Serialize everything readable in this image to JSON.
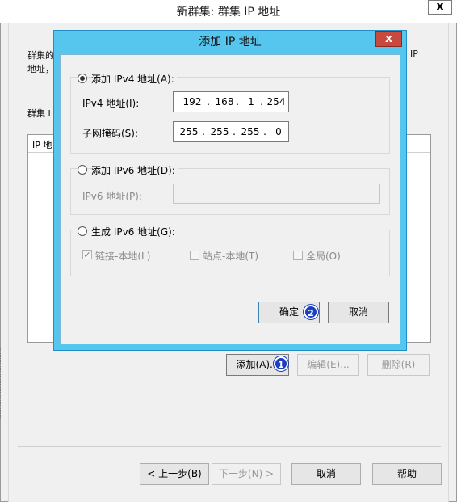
{
  "outer": {
    "title": "新群集: 群集 IP 地址",
    "close_label": "x",
    "desc_line1_left": "群集的",
    "desc_line1_right": "IP",
    "desc_line2": "地址，",
    "section_label": "群集 I",
    "list_header": "IP 地",
    "buttons": {
      "add": "添加(A)...",
      "edit": "编辑(E)...",
      "delete": "删除(R)"
    },
    "nav": {
      "back": "< 上一步(B)",
      "next": "下一步(N) >",
      "cancel": "取消",
      "help": "帮助"
    }
  },
  "dialog": {
    "title": "添加 IP 地址",
    "close_label": "x",
    "ipv4_option": "添加 IPv4 地址(A):",
    "ipv4_address_label": "IPv4 地址(I):",
    "ipv4_address": [
      "192",
      "168",
      "1",
      "254"
    ],
    "subnet_label": "子网掩码(S):",
    "subnet_mask": [
      "255",
      "255",
      "255",
      "0"
    ],
    "ipv6_option": "添加 IPv6 地址(D):",
    "ipv6_address_label": "IPv6 地址(P):",
    "ipv6_address_value": "",
    "gen_ipv6_option": "生成 IPv6 地址(G):",
    "link_local": "链接-本地(L)",
    "site_local": "站点-本地(T)",
    "global": "全局(O)",
    "ok_label": "确定",
    "cancel_label": "取消"
  },
  "badges": {
    "step1": "1",
    "step2": "2"
  }
}
